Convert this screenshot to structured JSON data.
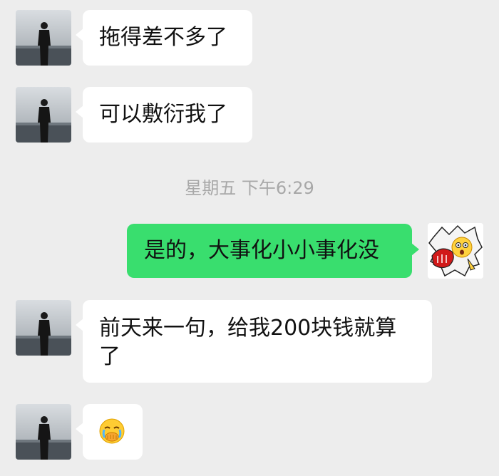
{
  "conversation": {
    "messages": [
      {
        "side": "in",
        "text": "拖得差不多了"
      },
      {
        "side": "in",
        "text": "可以敷衍我了"
      },
      {
        "side": "out",
        "text": "是的，大事化小小事化没"
      },
      {
        "side": "in",
        "text_line1": "前天来一句，给我200块钱就算",
        "text_line2": "了"
      },
      {
        "side": "in",
        "emoji": "face-with-hand-over-mouth-tears-emoji"
      }
    ],
    "timestamp": "星期五 下午6:29",
    "self_sticker": "fist-punch-shocked-face-sticker"
  },
  "colors": {
    "background": "#ededed",
    "incoming_bubble": "#ffffff",
    "outgoing_bubble": "#39de6e",
    "timestamp_text": "#a8a8a8"
  }
}
